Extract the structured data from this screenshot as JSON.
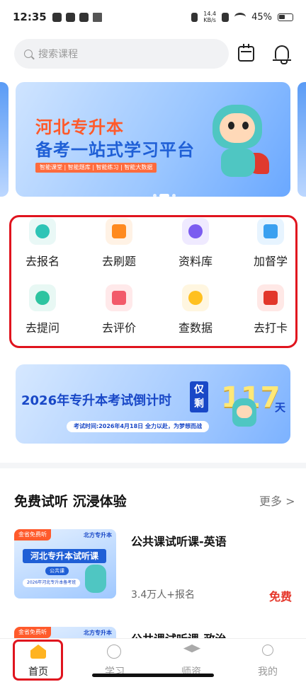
{
  "status_bar": {
    "time": "12:35",
    "net_speed_value": "14.4",
    "net_speed_unit": "KB/s",
    "battery": "45%"
  },
  "header": {
    "search_placeholder": "搜索课程",
    "calendar_icon": "calendar-icon",
    "notification_icon": "bell-icon"
  },
  "banner": {
    "title_line1": "河北专升本",
    "title_line2": "备考一站式学习平台",
    "tags": "智能课堂 | 智能题库 | 智能练习 | 智能大数据",
    "active_slide": 2,
    "slide_count": 3
  },
  "quick_grid": [
    {
      "label": "去报名",
      "icon": "search-icon",
      "color": "#e9f8f6",
      "accent": "#2ec4b6"
    },
    {
      "label": "去刷题",
      "icon": "pencil-icon",
      "color": "#fff2e5",
      "accent": "#ff8a1f"
    },
    {
      "label": "资料库",
      "icon": "document-icon",
      "color": "#efeaff",
      "accent": "#7b5cf0"
    },
    {
      "label": "加督学",
      "icon": "shield-icon",
      "color": "#e7f4ff",
      "accent": "#3aa0f0"
    },
    {
      "label": "去提问",
      "icon": "chat-icon",
      "color": "#e8f8f4",
      "accent": "#2ec4a0"
    },
    {
      "label": "去评价",
      "icon": "video-icon",
      "color": "#ffe9ea",
      "accent": "#f25a6a"
    },
    {
      "label": "查数据",
      "icon": "user-data-icon",
      "color": "#fff6e0",
      "accent": "#ffc020"
    },
    {
      "label": "去打卡",
      "icon": "calendar-check-icon",
      "color": "#ffe8e6",
      "accent": "#e2372b"
    }
  ],
  "countdown": {
    "title": "2026年专升本考试倒计时",
    "badge": "仅剩",
    "days": "117",
    "unit": "天",
    "subtitle": "考试时间:2026年4月18日   全力以赴，为梦想而战"
  },
  "free_section": {
    "title": "免费试听 沉浸体验",
    "more": "更多 >",
    "courses": [
      {
        "name": "公共课试听课-英语",
        "meta": "3.4万人+报名",
        "price": "免费",
        "thumb_tag": "金省免费听",
        "thumb_brand": "北方专升本",
        "thumb_title": "河北专升本试听课",
        "thumb_sub": "公共课",
        "thumb_foot": "2026年河北专升本备考班"
      },
      {
        "name": "公共课试听课-政治",
        "thumb_tag": "金省免费听",
        "thumb_brand": "北方专升本"
      }
    ]
  },
  "tabbar": [
    {
      "label": "首页",
      "icon": "home-icon",
      "active": true
    },
    {
      "label": "学习",
      "icon": "study-icon",
      "active": false
    },
    {
      "label": "师资",
      "icon": "graduation-cap-icon",
      "active": false
    },
    {
      "label": "我的",
      "icon": "profile-icon",
      "active": false
    }
  ]
}
